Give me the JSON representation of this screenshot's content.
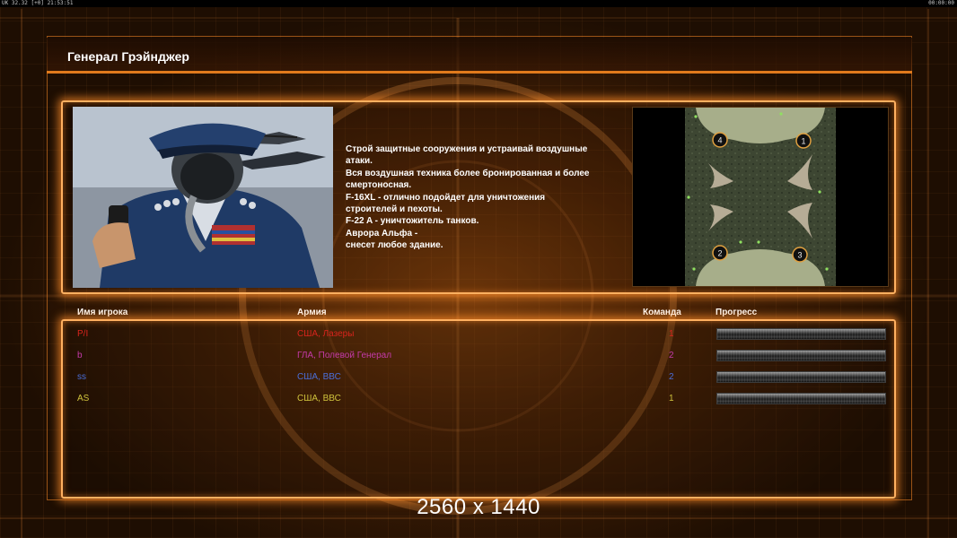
{
  "status_bar": {
    "left": "UK 32.32 [+0] 21:53:51",
    "right": "00:00:00"
  },
  "header": {
    "title": "Генерал Грэйнджер"
  },
  "briefing": {
    "lines": [
      "Строй защитные сооружения и устраивай воздушные",
      " атаки.",
      "Вся воздушная техника более бронированная и более",
      "смертоносная.",
      "F-16XL - отлично подойдет для уничтожения",
      " строителей и пехоты.",
      "F-22 A - уничтожитель танков.",
      "Аврора Альфа -",
      "снесет любое здание."
    ]
  },
  "minimap": {
    "start_positions": [
      "4",
      "1",
      "2",
      "3"
    ]
  },
  "table": {
    "headers": {
      "player": "Имя игрока",
      "army": "Армия",
      "team": "Команда",
      "progress": "Прогресс"
    },
    "rows": [
      {
        "name": "P/I",
        "army": "США, Лазеры",
        "team": "1",
        "color": "#d8241c"
      },
      {
        "name": "b",
        "army": "ГЛА, Полевой Генерал",
        "team": "2",
        "color": "#c43aa8"
      },
      {
        "name": "ss",
        "army": "США, ВВС",
        "team": "2",
        "color": "#4a6ed8"
      },
      {
        "name": "AS",
        "army": "США, ВВС",
        "team": "1",
        "color": "#cfc23c"
      }
    ]
  },
  "resolution_label": "2560 x 1440",
  "colors": {
    "accent": "#e07a1c",
    "glow": "#ffb060"
  }
}
